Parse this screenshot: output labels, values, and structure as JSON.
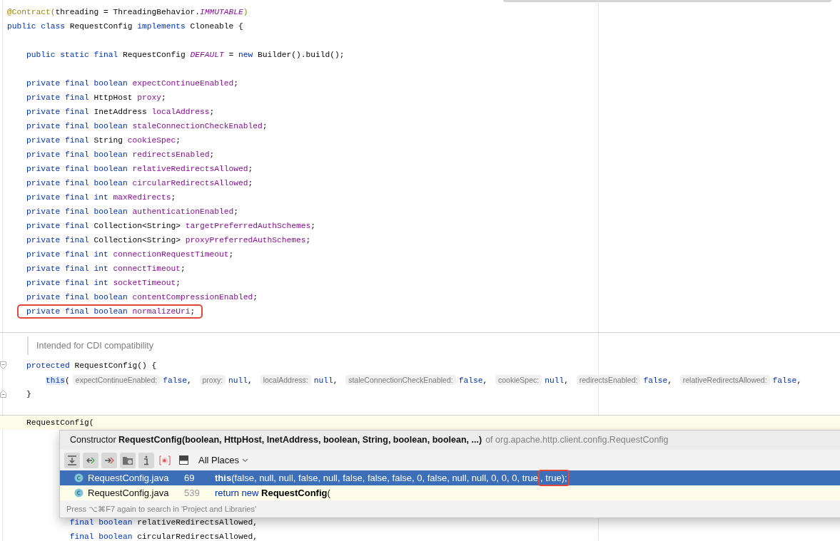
{
  "editor": {
    "lines": [
      {
        "kind": "code",
        "tokens": [
          {
            "kind": "annotation",
            "text": "@Contract("
          },
          {
            "kind": "plain",
            "text": "threading = ThreadingBehavior."
          },
          {
            "kind": "constant",
            "text": "IMMUTABLE"
          },
          {
            "kind": "annotation",
            "text": ")"
          }
        ]
      },
      {
        "kind": "code",
        "tokens": [
          {
            "kind": "keyword",
            "text": "public class "
          },
          {
            "kind": "plain",
            "text": "RequestConfig "
          },
          {
            "kind": "keyword",
            "text": "implements "
          },
          {
            "kind": "plain",
            "text": "Cloneable {"
          }
        ]
      },
      {
        "kind": "blank"
      },
      {
        "kind": "code",
        "tokens": [
          {
            "kind": "keyword",
            "text": "    public static final "
          },
          {
            "kind": "plain",
            "text": "RequestConfig "
          },
          {
            "kind": "constant",
            "text": "DEFAULT"
          },
          {
            "kind": "plain",
            "text": " = "
          },
          {
            "kind": "keyword",
            "text": "new "
          },
          {
            "kind": "plain",
            "text": "Builder().build();"
          }
        ]
      },
      {
        "kind": "blank"
      },
      {
        "kind": "code",
        "tokens": [
          {
            "kind": "keyword",
            "text": "    private final boolean "
          },
          {
            "kind": "field",
            "text": "expectContinueEnabled"
          },
          {
            "kind": "plain",
            "text": ";"
          }
        ]
      },
      {
        "kind": "code",
        "tokens": [
          {
            "kind": "keyword",
            "text": "    private final "
          },
          {
            "kind": "plain",
            "text": "HttpHost "
          },
          {
            "kind": "field",
            "text": "proxy"
          },
          {
            "kind": "plain",
            "text": ";"
          }
        ]
      },
      {
        "kind": "code",
        "tokens": [
          {
            "kind": "keyword",
            "text": "    private final "
          },
          {
            "kind": "plain",
            "text": "InetAddress "
          },
          {
            "kind": "field",
            "text": "localAddress"
          },
          {
            "kind": "plain",
            "text": ";"
          }
        ]
      },
      {
        "kind": "code",
        "tokens": [
          {
            "kind": "keyword",
            "text": "    private final boolean "
          },
          {
            "kind": "field",
            "text": "staleConnectionCheckEnabled"
          },
          {
            "kind": "plain",
            "text": ";"
          }
        ]
      },
      {
        "kind": "code",
        "tokens": [
          {
            "kind": "keyword",
            "text": "    private final "
          },
          {
            "kind": "plain",
            "text": "String "
          },
          {
            "kind": "field",
            "text": "cookieSpec"
          },
          {
            "kind": "plain",
            "text": ";"
          }
        ]
      },
      {
        "kind": "code",
        "tokens": [
          {
            "kind": "keyword",
            "text": "    private final boolean "
          },
          {
            "kind": "field",
            "text": "redirectsEnabled"
          },
          {
            "kind": "plain",
            "text": ";"
          }
        ]
      },
      {
        "kind": "code",
        "tokens": [
          {
            "kind": "keyword",
            "text": "    private final boolean "
          },
          {
            "kind": "field",
            "text": "relativeRedirectsAllowed"
          },
          {
            "kind": "plain",
            "text": ";"
          }
        ]
      },
      {
        "kind": "code",
        "tokens": [
          {
            "kind": "keyword",
            "text": "    private final boolean "
          },
          {
            "kind": "field",
            "text": "circularRedirectsAllowed"
          },
          {
            "kind": "plain",
            "text": ";"
          }
        ]
      },
      {
        "kind": "code",
        "tokens": [
          {
            "kind": "keyword",
            "text": "    private final int "
          },
          {
            "kind": "field",
            "text": "maxRedirects"
          },
          {
            "kind": "plain",
            "text": ";"
          }
        ]
      },
      {
        "kind": "code",
        "tokens": [
          {
            "kind": "keyword",
            "text": "    private final boolean "
          },
          {
            "kind": "field",
            "text": "authenticationEnabled"
          },
          {
            "kind": "plain",
            "text": ";"
          }
        ]
      },
      {
        "kind": "code",
        "tokens": [
          {
            "kind": "keyword",
            "text": "    private final "
          },
          {
            "kind": "plain",
            "text": "Collection<String> "
          },
          {
            "kind": "field",
            "text": "targetPreferredAuthSchemes"
          },
          {
            "kind": "plain",
            "text": ";"
          }
        ]
      },
      {
        "kind": "code",
        "tokens": [
          {
            "kind": "keyword",
            "text": "    private final "
          },
          {
            "kind": "plain",
            "text": "Collection<String> "
          },
          {
            "kind": "field",
            "text": "proxyPreferredAuthSchemes"
          },
          {
            "kind": "plain",
            "text": ";"
          }
        ]
      },
      {
        "kind": "code",
        "tokens": [
          {
            "kind": "keyword",
            "text": "    private final int "
          },
          {
            "kind": "field",
            "text": "connectionRequestTimeout"
          },
          {
            "kind": "plain",
            "text": ";"
          }
        ]
      },
      {
        "kind": "code",
        "tokens": [
          {
            "kind": "keyword",
            "text": "    private final int "
          },
          {
            "kind": "field",
            "text": "connectTimeout"
          },
          {
            "kind": "plain",
            "text": ";"
          }
        ]
      },
      {
        "kind": "code",
        "tokens": [
          {
            "kind": "keyword",
            "text": "    private final int "
          },
          {
            "kind": "field",
            "text": "socketTimeout"
          },
          {
            "kind": "plain",
            "text": ";"
          }
        ]
      },
      {
        "kind": "code",
        "tokens": [
          {
            "kind": "keyword",
            "text": "    private final boolean "
          },
          {
            "kind": "field",
            "text": "contentCompressionEnabled"
          },
          {
            "kind": "plain",
            "text": ";"
          }
        ]
      },
      {
        "kind": "code",
        "highlighted": true,
        "tokens": [
          {
            "kind": "keyword",
            "text": "    private final boolean "
          },
          {
            "kind": "field",
            "text": "normalizeUri"
          },
          {
            "kind": "plain",
            "text": ";"
          }
        ]
      },
      {
        "kind": "separator"
      },
      {
        "kind": "doc",
        "text": "Intended for CDI compatibility"
      },
      {
        "kind": "code",
        "fold_open": true,
        "tokens": [
          {
            "kind": "keyword",
            "text": "    protected "
          },
          {
            "kind": "plain",
            "text": "RequestConfig() {"
          }
        ]
      },
      {
        "kind": "code",
        "tokens": [
          {
            "kind": "usage",
            "text": "        this"
          },
          {
            "kind": "plain",
            "text": "("
          },
          {
            "kind": "hint",
            "text": "expectContinueEnabled:"
          },
          {
            "kind": "keyword",
            "text": "false"
          },
          {
            "kind": "plain",
            "text": ", "
          },
          {
            "kind": "hint",
            "text": "proxy:"
          },
          {
            "kind": "keyword",
            "text": "null"
          },
          {
            "kind": "plain",
            "text": ", "
          },
          {
            "kind": "hint",
            "text": "localAddress:"
          },
          {
            "kind": "keyword",
            "text": "null"
          },
          {
            "kind": "plain",
            "text": ", "
          },
          {
            "kind": "hint",
            "text": "staleConnectionCheckEnabled:"
          },
          {
            "kind": "keyword",
            "text": "false"
          },
          {
            "kind": "plain",
            "text": ", "
          },
          {
            "kind": "hint",
            "text": "cookieSpec:"
          },
          {
            "kind": "keyword",
            "text": "null"
          },
          {
            "kind": "plain",
            "text": ", "
          },
          {
            "kind": "hint",
            "text": "redirectsEnabled:"
          },
          {
            "kind": "keyword",
            "text": "false"
          },
          {
            "kind": "plain",
            "text": ", "
          },
          {
            "kind": "hint",
            "text": "relativeRedirectsAllowed:"
          },
          {
            "kind": "keyword",
            "text": "false"
          },
          {
            "kind": "plain",
            "text": ","
          }
        ]
      },
      {
        "kind": "code",
        "fold_close": true,
        "tokens": [
          {
            "kind": "plain",
            "text": "    }"
          }
        ]
      },
      {
        "kind": "separator"
      },
      {
        "kind": "code",
        "current": true,
        "tokens": [
          {
            "kind": "plain",
            "text": "    RequestConfig("
          }
        ]
      },
      {
        "kind": "hidden"
      },
      {
        "kind": "code",
        "tokens": [
          {
            "kind": "keyword",
            "text": "             final boolean "
          },
          {
            "kind": "plain",
            "text": "relativeRedirectsAllowed,"
          }
        ]
      },
      {
        "kind": "code",
        "tokens": [
          {
            "kind": "keyword",
            "text": "             final boolean "
          },
          {
            "kind": "plain",
            "text": "circularRedirectsAllowed,"
          }
        ]
      }
    ]
  },
  "popup": {
    "title": "Constructor **RequestConfig(boolean, HttpHost, InetAddress, boolean, String, boolean, boolean, ...)**",
    "owner": "of org.apache.http.client.config.RequestConfig",
    "toolbar": [
      {
        "kind": "expand",
        "on": true
      },
      {
        "kind": "prev",
        "on": true
      },
      {
        "kind": "next",
        "on": true
      },
      {
        "kind": "folder",
        "on": true
      },
      {
        "kind": "info",
        "on": true
      },
      {
        "kind": "method",
        "on": false
      },
      {
        "kind": "pin",
        "on": false
      }
    ],
    "scope": "All Places",
    "results": [
      {
        "file": "RequestConfig.java",
        "line": "69",
        "selected": true,
        "code": [
          {
            "kind": "bold",
            "text": "this"
          },
          {
            "kind": "plain",
            "text": "(false, null, null, false, null, false, false, false, 0, false, null, null, 0, 0, 0, true"
          },
          {
            "kind": "boxed",
            "text": ", true);"
          }
        ]
      },
      {
        "file": "RequestConfig.java",
        "line": "539",
        "selected": false,
        "code": [
          {
            "kind": "keyword",
            "text": "return new "
          },
          {
            "kind": "bold",
            "text": "RequestConfig"
          },
          {
            "kind": "plain",
            "text": "("
          }
        ]
      }
    ],
    "footer": "Press ⌥⌘F7 again to search in 'Project and Libraries'"
  }
}
